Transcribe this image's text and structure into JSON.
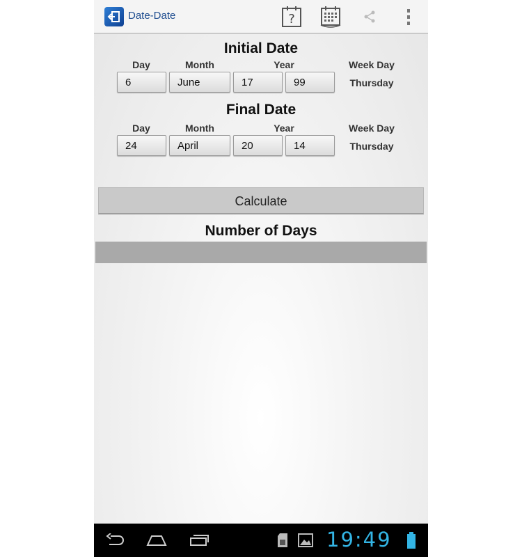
{
  "app": {
    "title": "Date-Date"
  },
  "initial": {
    "title": "Initial Date",
    "labels": {
      "day": "Day",
      "month": "Month",
      "year": "Year",
      "weekday": "Week Day"
    },
    "day": "6",
    "month": "June",
    "century": "17",
    "year": "99",
    "weekday": "Thursday"
  },
  "final": {
    "title": "Final Date",
    "labels": {
      "day": "Day",
      "month": "Month",
      "year": "Year",
      "weekday": "Week Day"
    },
    "day": "24",
    "month": "April",
    "century": "20",
    "year": "14",
    "weekday": "Thursday"
  },
  "calculate_label": "Calculate",
  "result": {
    "title": "Number of Days",
    "value": ""
  },
  "status": {
    "time": "19:49"
  },
  "icons": [
    "app-logo-icon",
    "help-icon",
    "calendar-icon",
    "share-icon",
    "overflow-menu-icon",
    "back-icon",
    "home-icon",
    "recent-apps-icon",
    "sd-card-icon",
    "gallery-icon",
    "battery-icon"
  ],
  "colors": {
    "accent": "#33b5e5",
    "title": "#1d4c8f",
    "result_bar": "#a9a9a9"
  }
}
